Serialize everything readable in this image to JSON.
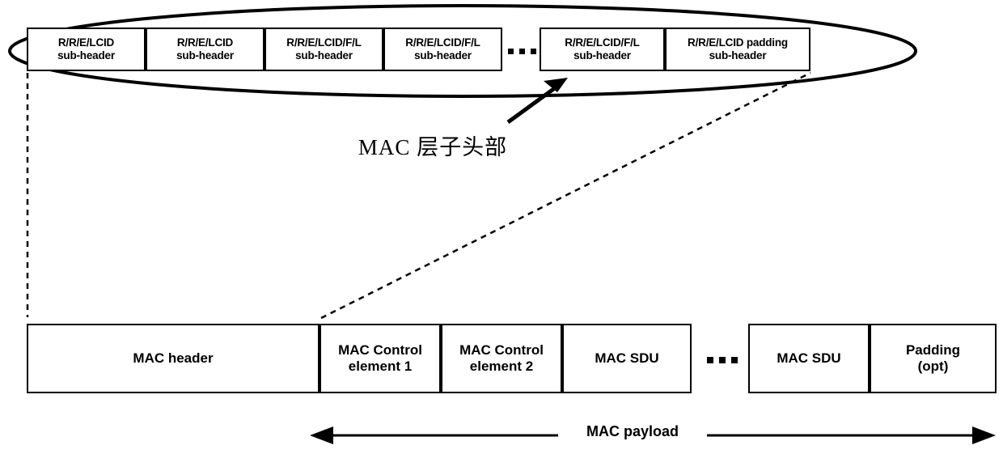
{
  "diagram": {
    "title_cn": "MAC 层子头部",
    "payload_label": "MAC payload",
    "colors": {
      "stroke": "#000000",
      "background": "#ffffff"
    },
    "subheader_row": {
      "cells": [
        {
          "line1": "R/R/E/LCID",
          "line2": "sub-header"
        },
        {
          "line1": "R/R/E/LCID",
          "line2": "sub-header"
        },
        {
          "line1": "R/R/E/LCID/F/L",
          "line2": "sub-header"
        },
        {
          "line1": "R/R/E/LCID/F/L",
          "line2": "sub-header"
        }
      ],
      "ellipsis": "...",
      "cells_after": [
        {
          "line1": "R/R/E/LCID/F/L",
          "line2": "sub-header"
        },
        {
          "line1": "R/R/E/LCID padding",
          "line2": "sub-header"
        }
      ]
    },
    "pdu_row": {
      "cells": [
        {
          "line1": "MAC header",
          "line2": ""
        },
        {
          "line1": "MAC Control",
          "line2": "element 1"
        },
        {
          "line1": "MAC Control",
          "line2": "element 2"
        },
        {
          "line1": "MAC SDU",
          "line2": ""
        }
      ],
      "ellipsis": "...",
      "cells_after": [
        {
          "line1": "MAC SDU",
          "line2": ""
        },
        {
          "line1": "Padding",
          "line2": "(opt)"
        }
      ]
    }
  }
}
